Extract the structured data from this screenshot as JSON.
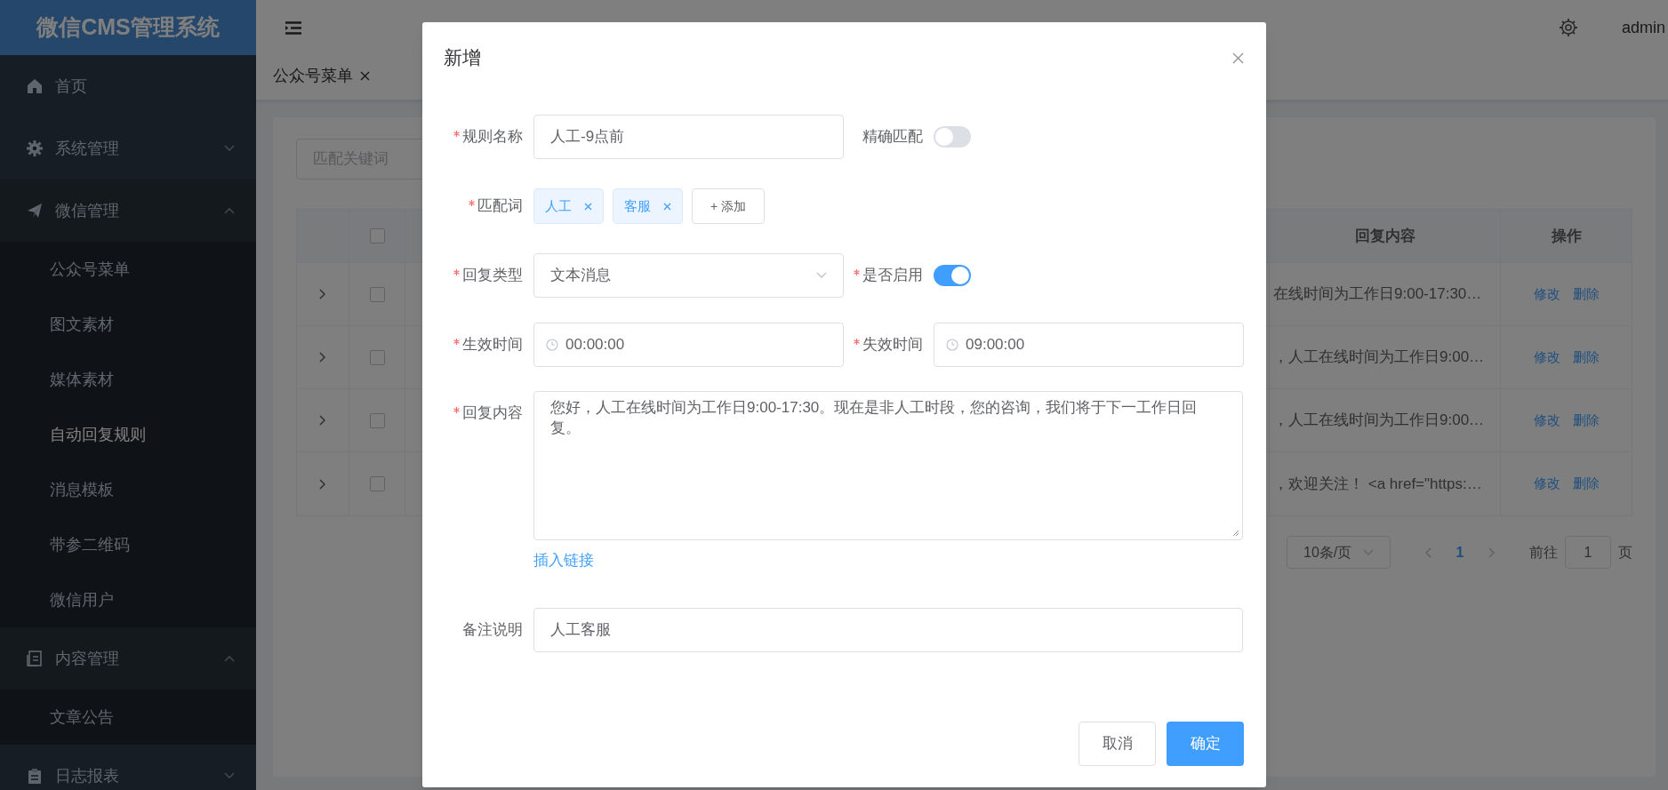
{
  "sidebar": {
    "logo": "微信CMS管理系统",
    "items": [
      {
        "label": "首页",
        "selected": false
      },
      {
        "label": "系统管理",
        "selected": false,
        "expanded": false
      },
      {
        "label": "微信管理",
        "selected": false,
        "expanded": true,
        "children": [
          {
            "label": "公众号菜单",
            "selected": false
          },
          {
            "label": "图文素材",
            "selected": false
          },
          {
            "label": "媒体素材",
            "selected": false
          },
          {
            "label": "自动回复规则",
            "selected": true
          },
          {
            "label": "消息模板",
            "selected": false
          },
          {
            "label": "带参二维码",
            "selected": false
          },
          {
            "label": "微信用户",
            "selected": false
          }
        ]
      },
      {
        "label": "内容管理",
        "selected": false,
        "expanded": true,
        "children": [
          {
            "label": "文章公告",
            "selected": false
          }
        ]
      },
      {
        "label": "日志报表",
        "selected": false,
        "expanded": false
      }
    ]
  },
  "header": {
    "user": "admin"
  },
  "tabs": [
    {
      "label": "公众号菜单",
      "selected": false
    }
  ],
  "search": {
    "placeholder": "匹配关键词"
  },
  "table": {
    "header_checked": false,
    "columns": [
      "回复内容",
      "操作"
    ],
    "rows": [
      {
        "checked": false,
        "reply": "在线时间为工作日9:00-17:30…",
        "actions": [
          "修改",
          "删除"
        ]
      },
      {
        "checked": false,
        "reply": "，人工在线时间为工作日9:00…",
        "actions": [
          "修改",
          "删除"
        ]
      },
      {
        "checked": false,
        "reply": "，人工在线时间为工作日9:00…",
        "actions": [
          "修改",
          "删除"
        ]
      },
      {
        "checked": false,
        "reply": "，欢迎关注！ <a href=\"https:…",
        "actions": [
          "修改",
          "删除"
        ]
      }
    ]
  },
  "pagination": {
    "page_size": "10条/页",
    "pages": [
      {
        "label": "1",
        "selected": true
      }
    ],
    "goto_label": "前往",
    "goto_value": "1",
    "suffix": "页"
  },
  "dialog": {
    "title": "新增",
    "rows": [
      {
        "fields": [
          {
            "kind": "text",
            "label": "规则名称",
            "required": true,
            "value": "人工-9点前"
          },
          {
            "kind": "switch",
            "label": "精确匹配",
            "required": false,
            "on": false
          }
        ]
      },
      {
        "fields": [
          {
            "kind": "tags",
            "label": "匹配词",
            "required": true,
            "tags": [
              "人工",
              "客服"
            ],
            "add_label": "+ 添加"
          }
        ]
      },
      {
        "fields": [
          {
            "kind": "select",
            "label": "回复类型",
            "required": true,
            "value": "文本消息"
          },
          {
            "kind": "switch",
            "label": "是否启用",
            "required": true,
            "on": true
          }
        ]
      },
      {
        "fields": [
          {
            "kind": "time",
            "label": "生效时间",
            "required": true,
            "value": "00:00:00"
          },
          {
            "kind": "time",
            "label": "失效时间",
            "required": true,
            "value": "09:00:00"
          }
        ]
      },
      {
        "fields": [
          {
            "kind": "textarea",
            "label": "回复内容",
            "required": true,
            "value": "您好，人工在线时间为工作日9:00-17:30。现在是非人工时段，您的咨询，我们将于下一工作日回复。",
            "link": "插入链接"
          }
        ]
      },
      {
        "fields": [
          {
            "kind": "text",
            "label": "备注说明",
            "required": false,
            "value": "人工客服"
          }
        ]
      }
    ],
    "buttons": [
      {
        "label": "取消",
        "primary": false
      },
      {
        "label": "确定",
        "primary": true
      }
    ]
  }
}
